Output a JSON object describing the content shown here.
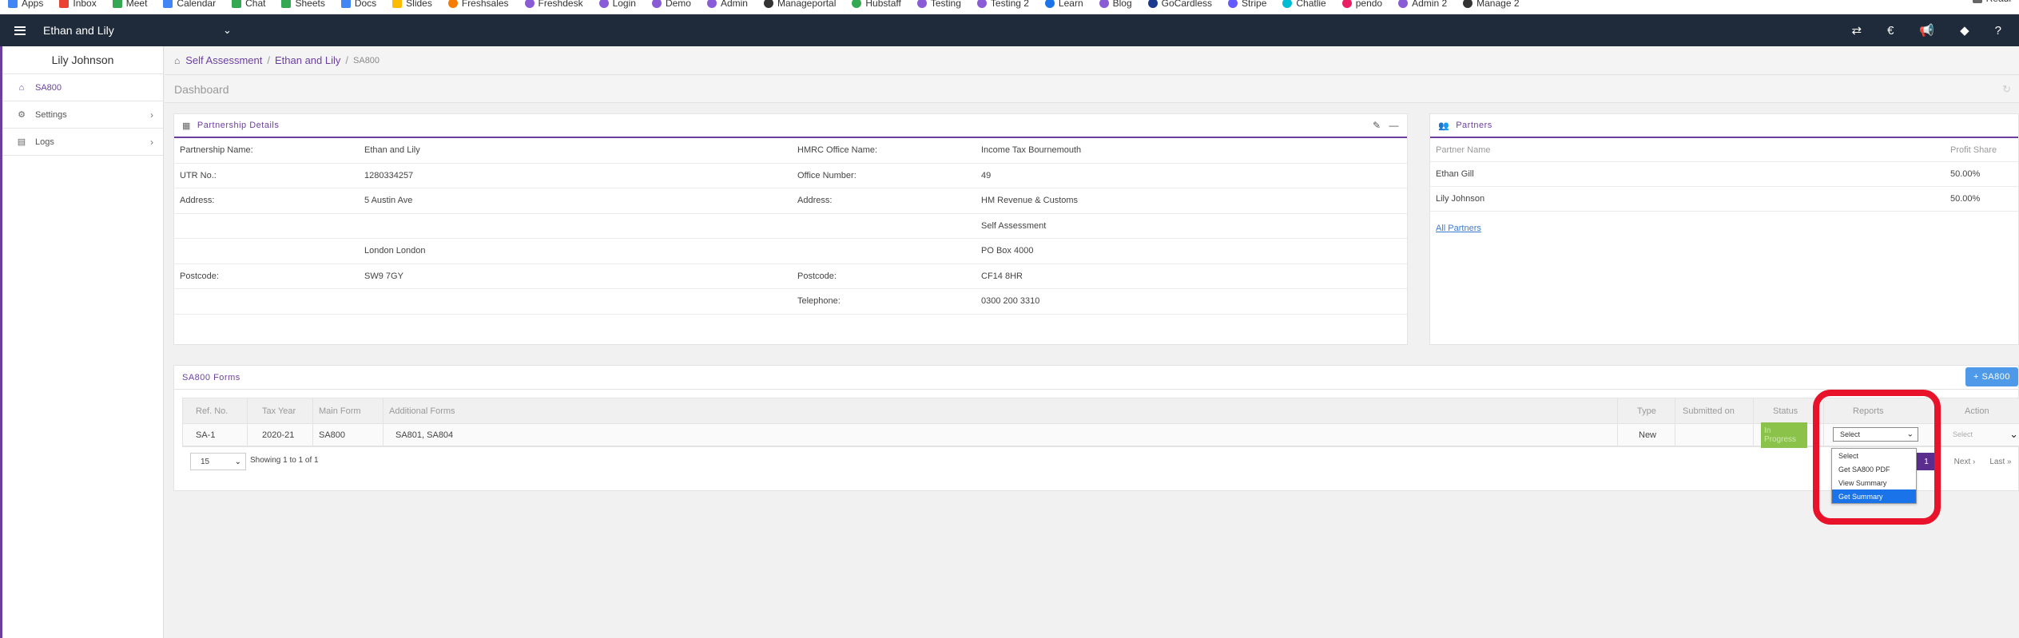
{
  "bookmarks": [
    {
      "label": "Apps",
      "color": "#4285f4"
    },
    {
      "label": "Inbox",
      "color": "#ea4335"
    },
    {
      "label": "Meet",
      "color": "#34a853"
    },
    {
      "label": "Calendar",
      "color": "#4285f4"
    },
    {
      "label": "Chat",
      "color": "#34a853"
    },
    {
      "label": "Sheets",
      "color": "#34a853"
    },
    {
      "label": "Docs",
      "color": "#4285f4"
    },
    {
      "label": "Slides",
      "color": "#fbbc05"
    },
    {
      "label": "Freshsales",
      "color": "#f57c00"
    },
    {
      "label": "Freshdesk",
      "color": "#8a5bd6"
    },
    {
      "label": "Login",
      "color": "#8a5bd6"
    },
    {
      "label": "Demo",
      "color": "#8a5bd6"
    },
    {
      "label": "Admin",
      "color": "#8a5bd6"
    },
    {
      "label": "Manageportal",
      "color": "#333333"
    },
    {
      "label": "Hubstaff",
      "color": "#34a853"
    },
    {
      "label": "Testing",
      "color": "#8a5bd6"
    },
    {
      "label": "Testing 2",
      "color": "#8a5bd6"
    },
    {
      "label": "Learn",
      "color": "#1a73e8"
    },
    {
      "label": "Blog",
      "color": "#8a5bd6"
    },
    {
      "label": "GoCardless",
      "color": "#1a3a8f"
    },
    {
      "label": "Stripe",
      "color": "#635bff"
    },
    {
      "label": "Chatlie",
      "color": "#00bcd4"
    },
    {
      "label": "pendo",
      "color": "#e91e63"
    },
    {
      "label": "Admin 2",
      "color": "#8a5bd6"
    },
    {
      "label": "Manage 2",
      "color": "#333333"
    }
  ],
  "bookmarks_right": "Readi",
  "topbar": {
    "client_name": "Ethan and Lily",
    "icons": [
      "transfer-icon",
      "euro-icon",
      "announcement-icon",
      "tag-icon",
      "help-icon"
    ]
  },
  "sidebar": {
    "user_name": "Lily Johnson",
    "items": [
      {
        "label": "SA800",
        "icon": "home-icon",
        "active": true
      },
      {
        "label": "Settings",
        "icon": "gear-icon",
        "active": false
      },
      {
        "label": "Logs",
        "icon": "file-icon",
        "active": false
      }
    ]
  },
  "breadcrumb": {
    "items": [
      "Self Assessment",
      "Ethan and Lily"
    ],
    "current": "SA800"
  },
  "dashboard_title": "Dashboard",
  "partnership": {
    "title": "Partnership Details",
    "rows": [
      {
        "l1": "Partnership Name:",
        "v1": "Ethan and Lily",
        "l2": "HMRC Office Name:",
        "v2": "Income Tax Bournemouth"
      },
      {
        "l1": "UTR No.:",
        "v1": "1280334257",
        "l2": "Office Number:",
        "v2": "49"
      },
      {
        "l1": "Address:",
        "v1": "5 Austin Ave",
        "l2": "Address:",
        "v2": "HM Revenue & Customs"
      },
      {
        "l1": "",
        "v1": "",
        "l2": "",
        "v2": "Self Assessment"
      },
      {
        "l1": "",
        "v1": "London London",
        "l2": "",
        "v2": "PO Box 4000"
      },
      {
        "l1": "Postcode:",
        "v1": "SW9 7GY",
        "l2": "Postcode:",
        "v2": "CF14 8HR"
      },
      {
        "l1": "",
        "v1": "",
        "l2": "Telephone:",
        "v2": "0300 200 3310"
      }
    ]
  },
  "partners": {
    "title": "Partners",
    "headers": {
      "name": "Partner Name",
      "share": "Profit Share"
    },
    "rows": [
      {
        "name": "Ethan Gill",
        "share": "50.00%"
      },
      {
        "name": "Lily Johnson",
        "share": "50.00%"
      }
    ],
    "all_link": "All Partners"
  },
  "forms": {
    "title": "SA800 Forms",
    "add_button": "+ SA800",
    "headers": {
      "ref": "Ref. No.",
      "year": "Tax Year",
      "main": "Main Form",
      "additional": "Additional Forms",
      "type": "Type",
      "submitted": "Submitted on",
      "status": "Status",
      "reports": "Reports",
      "action": "Action"
    },
    "rows": [
      {
        "ref": "SA-1",
        "year": "2020-21",
        "main": "SA800",
        "additional": "SA801, SA804",
        "type": "New",
        "submitted": "",
        "status": "In Progress",
        "reports_value": "Select",
        "action_value": "Select"
      }
    ],
    "page_size": "15",
    "showing": "Showing 1 to 1 of 1",
    "pagination": {
      "current": "1",
      "next": "Next ›",
      "last": "Last »"
    }
  },
  "reports_dropdown": {
    "options": [
      "Select",
      "Get SA800 PDF",
      "View Summary",
      "Get Summary"
    ],
    "selected_index": 3
  },
  "colors": {
    "accent": "#6b3fa0",
    "navbar": "#1f2a3a",
    "primary_button": "#4e9ae8",
    "status_green": "#8bc34a",
    "highlight": "#e8132a"
  }
}
